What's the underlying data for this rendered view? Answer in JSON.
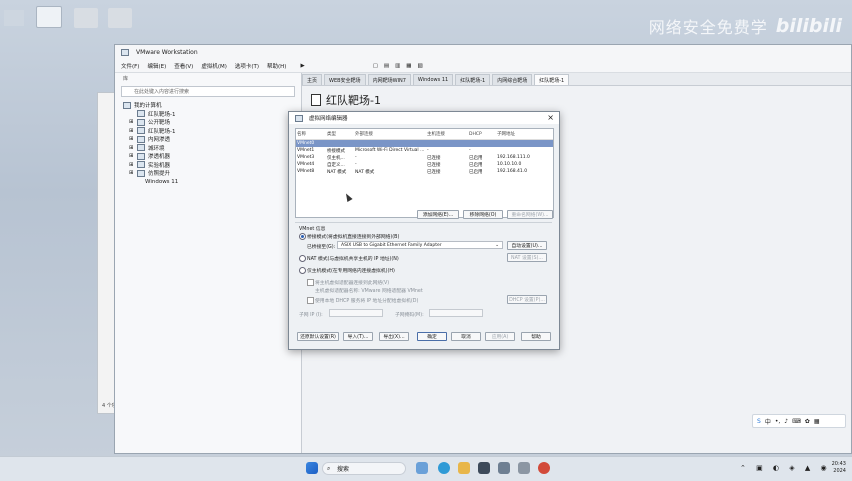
{
  "watermark": {
    "text": "网络安全免费学",
    "logo": "bilibili"
  },
  "vmware": {
    "title": "VMware Workstation",
    "menu": [
      "文件(F)",
      "编辑(E)",
      "查看(V)",
      "虚拟机(M)",
      "选项卡(T)",
      "帮助(H)"
    ],
    "library_header": "库",
    "search_placeholder": "在此处键入内容进行搜索",
    "tree": [
      "我的计算机",
      "红队靶场-1",
      "公开靶场",
      "红队靶场-1",
      "内网渗透",
      "城环境",
      "渗透机器",
      "实验机器",
      "仿照提升",
      "Windows 11"
    ],
    "tabs": [
      "主页",
      "WEB安全靶场",
      "内网靶场WIN7",
      "Windows 11",
      "红队靶场-1",
      "内网综合靶场",
      "红队靶场-1"
    ],
    "vm_heading": "红队靶场-1"
  },
  "dialog": {
    "title": "虚拟网络编辑器",
    "columns": [
      "名称",
      "类型",
      "外部连接",
      "主机连接",
      "DHCP",
      "子网地址"
    ],
    "rows": [
      {
        "name": "VMnet0",
        "type": "",
        "external": "",
        "host": "",
        "dhcp": "",
        "subnet": "",
        "selected": true
      },
      {
        "name": "VMnet1",
        "type": "桥接模式",
        "external": "Microsoft Wi-Fi Direct Virtual ...",
        "host": "-",
        "dhcp": "-",
        "subnet": "",
        "selected": false
      },
      {
        "name": "VMnet3",
        "type": "仅主机...",
        "external": "-",
        "host": "已连接",
        "dhcp": "已启用",
        "subnet": "192.168.111.0",
        "selected": false
      },
      {
        "name": "VMnet4",
        "type": "自定义...",
        "external": "-",
        "host": "已连接",
        "dhcp": "已启用",
        "subnet": "10.10.10.0",
        "selected": false
      },
      {
        "name": "VMnet8",
        "type": "NAT 模式",
        "external": "NAT 模式",
        "host": "已连接",
        "dhcp": "已启用",
        "subnet": "192.168.41.0",
        "selected": false
      }
    ],
    "add_network": "添加网络(E)...",
    "remove_network": "移除网络(O)",
    "rename_network": "重命名网络(W)...",
    "info_label": "VMnet 信息",
    "radio_bridge": "桥接模式(将虚拟机直接连接到外部网络)(B)",
    "bridge_to_label": "已桥接至(G):",
    "bridge_adapter": "ASIX USB to Gigabit Ethernet Family Adapter",
    "auto_settings": "自动设置(U)...",
    "radio_nat": "NAT 模式(与虚拟机共享主机的 IP 地址)(N)",
    "nat_settings": "NAT 设置(S)...",
    "radio_host": "仅主机模式(在专用网络内连接虚拟机)(H)",
    "chk_host_adapter": "将主机虚拟适配器连接到此网络(V)",
    "host_adapter_name": "主机虚拟适配器名称: VMware 网络适配器 VMnet",
    "chk_dhcp": "使用本地 DHCP 服务将 IP 地址分配给虚拟机(D)",
    "dhcp_settings": "DHCP 设置(P)...",
    "subnet_ip": "子网 IP (I):",
    "subnet_mask": "子网掩码(M):",
    "restore_defaults": "还原默认设置(R)",
    "import": "导入(T)...",
    "export": "导出(X)...",
    "ok": "确定",
    "cancel": "取消",
    "apply": "应用(A)",
    "help": "帮助"
  },
  "explorer": {
    "status": "4 个项目"
  },
  "taskbar": {
    "search_label": "搜索",
    "time": "20:43",
    "date": "2024"
  }
}
